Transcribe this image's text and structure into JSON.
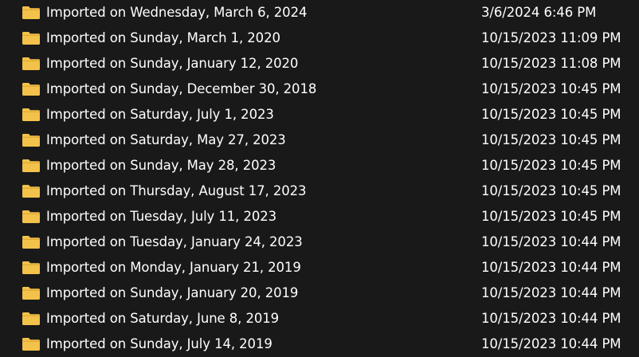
{
  "theme": {
    "background": "#191919",
    "text": "#ffffff",
    "folder_color": "#F3C24A"
  },
  "columns": {
    "name_header": "",
    "date_header": ""
  },
  "rows": [
    {
      "icon": "folder-icon",
      "name": "Imported on Wednesday, March 6, 2024",
      "date_modified": "3/6/2024 6:46 PM"
    },
    {
      "icon": "folder-icon",
      "name": "Imported on Sunday, March 1, 2020",
      "date_modified": "10/15/2023 11:09 PM"
    },
    {
      "icon": "folder-icon",
      "name": "Imported on Sunday, January 12, 2020",
      "date_modified": "10/15/2023 11:08 PM"
    },
    {
      "icon": "folder-icon",
      "name": "Imported on Sunday, December 30, 2018",
      "date_modified": "10/15/2023 10:45 PM"
    },
    {
      "icon": "folder-icon",
      "name": "Imported on Saturday, July 1, 2023",
      "date_modified": "10/15/2023 10:45 PM"
    },
    {
      "icon": "folder-icon",
      "name": "Imported on Saturday, May 27, 2023",
      "date_modified": "10/15/2023 10:45 PM"
    },
    {
      "icon": "folder-icon",
      "name": "Imported on Sunday, May 28, 2023",
      "date_modified": "10/15/2023 10:45 PM"
    },
    {
      "icon": "folder-icon",
      "name": "Imported on Thursday, August 17, 2023",
      "date_modified": "10/15/2023 10:45 PM"
    },
    {
      "icon": "folder-icon",
      "name": "Imported on Tuesday, July 11, 2023",
      "date_modified": "10/15/2023 10:45 PM"
    },
    {
      "icon": "folder-icon",
      "name": "Imported on Tuesday, January 24, 2023",
      "date_modified": "10/15/2023 10:44 PM"
    },
    {
      "icon": "folder-icon",
      "name": "Imported on Monday, January 21, 2019",
      "date_modified": "10/15/2023 10:44 PM"
    },
    {
      "icon": "folder-icon",
      "name": "Imported on Sunday, January 20, 2019",
      "date_modified": "10/15/2023 10:44 PM"
    },
    {
      "icon": "folder-icon",
      "name": "Imported on Saturday, June 8, 2019",
      "date_modified": "10/15/2023 10:44 PM"
    },
    {
      "icon": "folder-icon",
      "name": "Imported on Sunday, July 14, 2019",
      "date_modified": "10/15/2023 10:44 PM"
    }
  ]
}
